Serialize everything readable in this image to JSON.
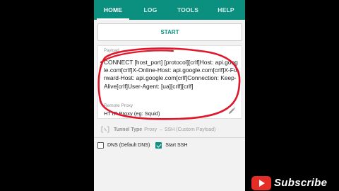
{
  "tabs": {
    "home": "HOME",
    "log": "LOG",
    "tools": "TOOLS",
    "help": "HELP"
  },
  "start_button": "START",
  "payload": {
    "label": "Payload",
    "value": "CONNECT [host_port] [protocol][crlf]Host: api.google.com[crlf]X-Online-Host: api.google.com[crlf]X-Forward-Host: api.google.com[crlf]Connection: Keep-Alive[crlf]User-Agent: [ua][crlf][crlf]"
  },
  "remote_proxy": {
    "label": "Remote Proxy",
    "value": "HTTP Proxy (eg: Squid)"
  },
  "tunnel": {
    "label": "Tunnel Type",
    "value": "Proxy → SSH (Custom Payload)"
  },
  "options": {
    "dns": {
      "label": "DNS (Default DNS)",
      "checked": false
    },
    "ssh": {
      "label": "Start SSH",
      "checked": true
    }
  },
  "overlay": {
    "subscribe_text": "Subscribe"
  },
  "colors": {
    "accent": "#0b8f7f",
    "annotation": "#e0162b",
    "youtube_red": "#e52d27"
  },
  "icons": {
    "edit": "pencil-icon",
    "tunnel": "tunnel-icon",
    "youtube": "youtube-logo"
  }
}
